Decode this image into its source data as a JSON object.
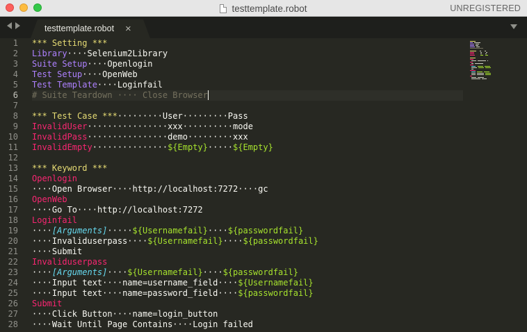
{
  "window": {
    "title": "testtemplate.robot",
    "status": "UNREGISTERED"
  },
  "tab": {
    "label": "testtemplate.robot",
    "close_glyph": "×"
  },
  "lines": [
    [
      [
        "*** Setting ***",
        "hdr"
      ]
    ],
    [
      [
        "Library",
        "kw"
      ],
      [
        "····",
        "ws"
      ],
      [
        "Selenium2Library",
        "df"
      ]
    ],
    [
      [
        "Suite Setup",
        "kw"
      ],
      [
        "····",
        "ws"
      ],
      [
        "Openlogin",
        "df"
      ]
    ],
    [
      [
        "Test Setup",
        "kw"
      ],
      [
        "····",
        "ws"
      ],
      [
        "OpenWeb",
        "df"
      ]
    ],
    [
      [
        "Test Template",
        "kw"
      ],
      [
        "····",
        "ws"
      ],
      [
        "Loginfail",
        "df"
      ]
    ],
    [
      [
        "# Suite Teardown ···· Close Browser",
        "cm"
      ]
    ],
    [],
    [
      [
        "*** Test Case ***",
        "hdr"
      ],
      [
        "·········",
        "ws"
      ],
      [
        "User",
        "df"
      ],
      [
        "·········",
        "ws"
      ],
      [
        "Pass",
        "df"
      ]
    ],
    [
      [
        "InvalidUser",
        "tc"
      ],
      [
        "················",
        "ws"
      ],
      [
        "xxx",
        "df"
      ],
      [
        "··········",
        "ws"
      ],
      [
        "mode",
        "df"
      ]
    ],
    [
      [
        "InvalidPass",
        "tc"
      ],
      [
        "················",
        "ws"
      ],
      [
        "demo",
        "df"
      ],
      [
        "·········",
        "ws"
      ],
      [
        "xxx",
        "df"
      ]
    ],
    [
      [
        "InvalidEmpty",
        "tc"
      ],
      [
        "···············",
        "ws"
      ],
      [
        "${Empty}",
        "var"
      ],
      [
        "·····",
        "ws"
      ],
      [
        "${Empty}",
        "var"
      ]
    ],
    [],
    [
      [
        "*** Keyword ***",
        "hdr"
      ]
    ],
    [
      [
        "Openlogin",
        "tc"
      ]
    ],
    [
      [
        "····",
        "ws"
      ],
      [
        "Open Browser",
        "df"
      ],
      [
        "····",
        "ws"
      ],
      [
        "http://localhost:7272",
        "df"
      ],
      [
        "····",
        "ws"
      ],
      [
        "gc",
        "df"
      ]
    ],
    [
      [
        "OpenWeb",
        "tc"
      ]
    ],
    [
      [
        "····",
        "ws"
      ],
      [
        "Go To",
        "df"
      ],
      [
        "····",
        "ws"
      ],
      [
        "http://localhost:7272",
        "df"
      ]
    ],
    [
      [
        "Loginfail",
        "tc"
      ]
    ],
    [
      [
        "····",
        "ws"
      ],
      [
        "[Arguments]",
        "arg"
      ],
      [
        "·····",
        "ws"
      ],
      [
        "${Usernamefail}",
        "var"
      ],
      [
        "····",
        "ws"
      ],
      [
        "${passwordfail}",
        "var"
      ]
    ],
    [
      [
        "····",
        "ws"
      ],
      [
        "Invaliduserpass",
        "df"
      ],
      [
        "····",
        "ws"
      ],
      [
        "${Usernamefail}",
        "var"
      ],
      [
        "····",
        "ws"
      ],
      [
        "${passwordfail}",
        "var"
      ]
    ],
    [
      [
        "····",
        "ws"
      ],
      [
        "Submit",
        "df"
      ]
    ],
    [
      [
        "Invaliduserpass",
        "tc"
      ]
    ],
    [
      [
        "····",
        "ws"
      ],
      [
        "[Arguments]",
        "arg"
      ],
      [
        "····",
        "ws"
      ],
      [
        "${Usernamefail}",
        "var"
      ],
      [
        "····",
        "ws"
      ],
      [
        "${passwordfail}",
        "var"
      ]
    ],
    [
      [
        "····",
        "ws"
      ],
      [
        "Input text",
        "df"
      ],
      [
        "····",
        "ws"
      ],
      [
        "name=username_field",
        "df"
      ],
      [
        "····",
        "ws"
      ],
      [
        "${Usernamefail}",
        "var"
      ]
    ],
    [
      [
        "····",
        "ws"
      ],
      [
        "Input text",
        "df"
      ],
      [
        "····",
        "ws"
      ],
      [
        "name=password_field",
        "df"
      ],
      [
        "····",
        "ws"
      ],
      [
        "${passwordfail}",
        "var"
      ]
    ],
    [
      [
        "Submit",
        "tc"
      ]
    ],
    [
      [
        "····",
        "ws"
      ],
      [
        "Click Button",
        "df"
      ],
      [
        "····",
        "ws"
      ],
      [
        "name=login_button",
        "df"
      ]
    ],
    [
      [
        "····",
        "ws"
      ],
      [
        "Wait Until Page Contains",
        "df"
      ],
      [
        "····",
        "ws"
      ],
      [
        "Login failed",
        "df"
      ]
    ]
  ],
  "current_line": 6,
  "colors": {
    "background": "#272822",
    "header": "#e6db74",
    "setting_keyword": "#ae81ff",
    "test_case": "#f92672",
    "variable": "#a6e22e",
    "arguments": "#66d9ef",
    "comment": "#75715e",
    "text": "#f8f8f2"
  }
}
